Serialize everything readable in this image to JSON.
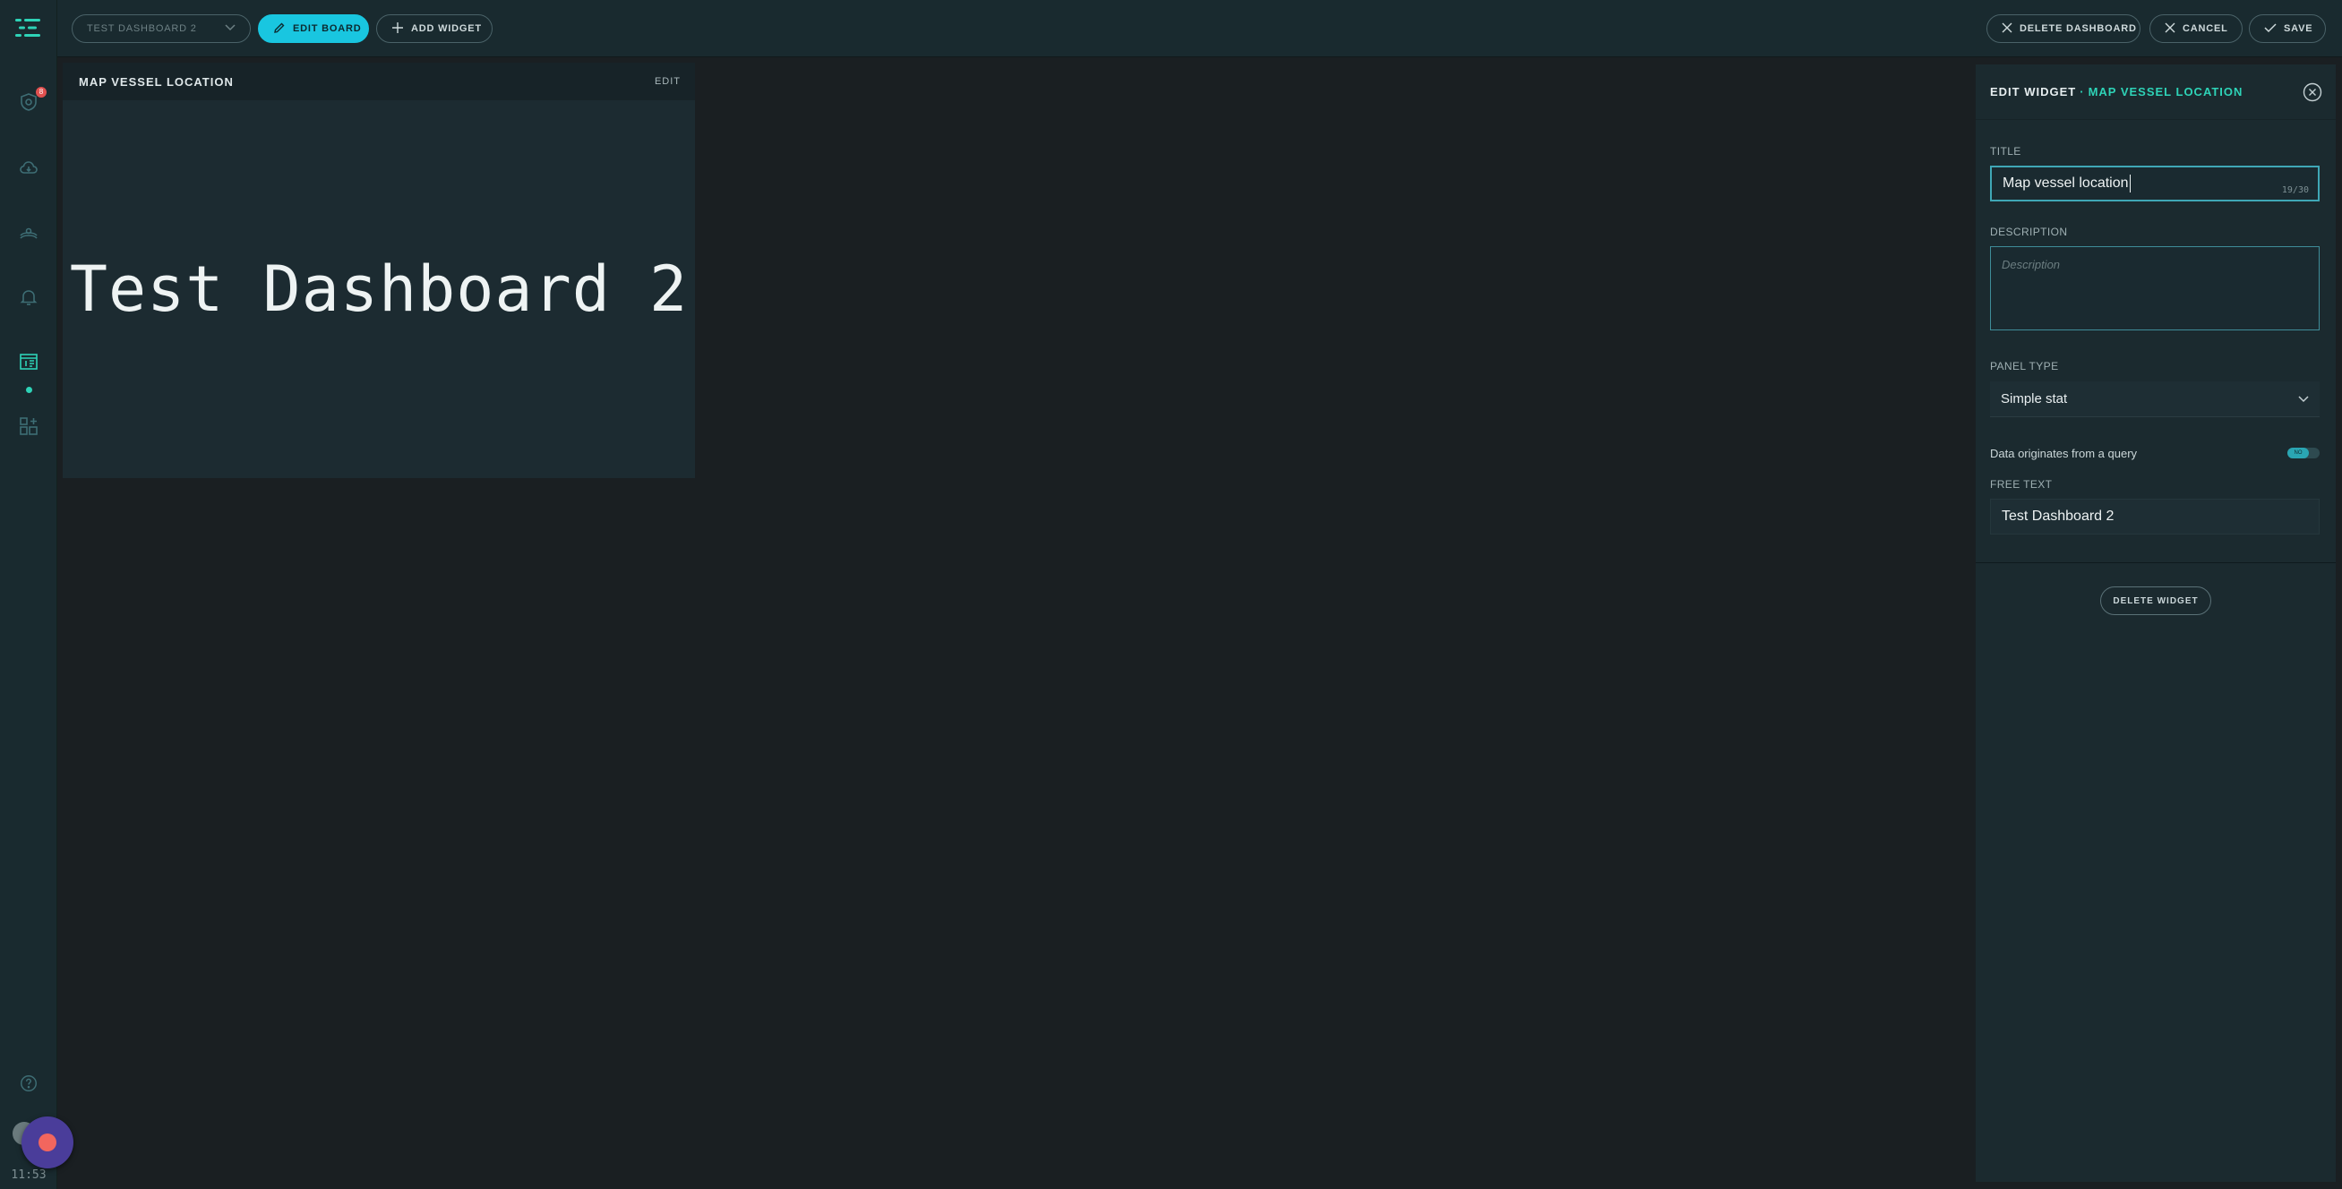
{
  "sidebar": {
    "logo": "app-logo",
    "items": [
      {
        "icon": "shield-icon",
        "badge": "8"
      },
      {
        "icon": "cloud-icon"
      },
      {
        "icon": "vessel-icon"
      },
      {
        "icon": "bell-icon"
      },
      {
        "icon": "dashboard-icon",
        "active": true
      },
      {
        "icon": "widgets-icon"
      }
    ],
    "help_icon": "help-icon",
    "time": "11:53"
  },
  "topbar": {
    "dashboard_select": "TEST DASHBOARD 2",
    "edit_board": "EDIT BOARD",
    "add_widget": "ADD WIDGET",
    "delete_dashboard": "DELETE DASHBOARD",
    "cancel": "CANCEL",
    "save": "SAVE"
  },
  "widget": {
    "title": "MAP VESSEL LOCATION",
    "edit": "EDIT",
    "content": "Test Dashboard 2"
  },
  "panel": {
    "heading": "EDIT WIDGET",
    "separator": "·",
    "subheading": "MAP VESSEL LOCATION",
    "title_label": "TITLE",
    "title_value": "Map vessel location",
    "title_counter": "19/30",
    "description_label": "DESCRIPTION",
    "description_placeholder": "Description",
    "panel_type_label": "PANEL TYPE",
    "panel_type_value": "Simple stat",
    "query_toggle_label": "Data originates from a query",
    "query_toggle_state": "NO",
    "free_text_label": "FREE TEXT",
    "free_text_value": "Test Dashboard 2",
    "delete_widget": "DELETE WIDGET"
  },
  "colors": {
    "accent": "#19c6e0",
    "teal": "#2ed3b7",
    "background": "#1a1f22",
    "surface": "#1b2a2f",
    "record": "#f2665e"
  }
}
